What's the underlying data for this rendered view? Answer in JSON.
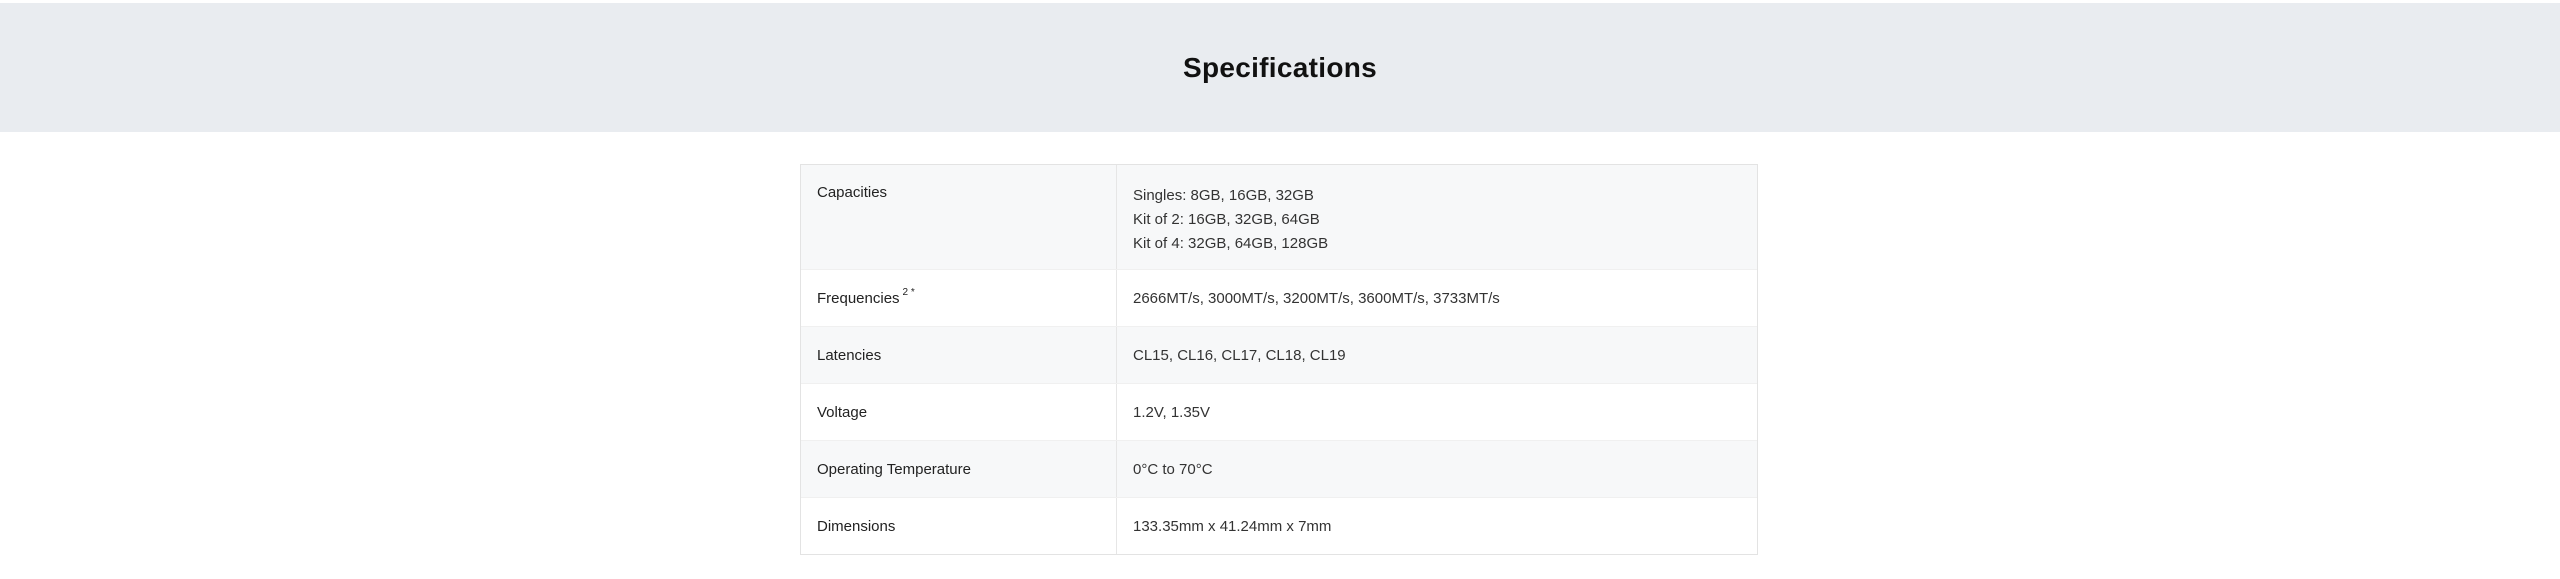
{
  "page": {
    "title": "Specifications"
  },
  "specs": {
    "capacities": {
      "label": "Capacities",
      "values": [
        "Singles: 8GB, 16GB, 32GB",
        "Kit of 2: 16GB, 32GB, 64GB",
        "Kit of 4: 32GB, 64GB, 128GB"
      ]
    },
    "frequencies": {
      "label": "Frequencies",
      "sup": "2 *",
      "value": "2666MT/s, 3000MT/s, 3200MT/s, 3600MT/s, 3733MT/s"
    },
    "latencies": {
      "label": "Latencies",
      "value": "CL15, CL16, CL17, CL18, CL19"
    },
    "voltage": {
      "label": "Voltage",
      "value": "1.2V, 1.35V"
    },
    "operating_temperature": {
      "label": "Operating Temperature",
      "value": "0°C to 70°C"
    },
    "dimensions": {
      "label": "Dimensions",
      "value": "133.35mm x 41.24mm x 7mm"
    }
  },
  "colors": {
    "header_background": "#e9ecf0",
    "row_shaded": "#f7f8f9",
    "border": "#e3e3e3"
  }
}
